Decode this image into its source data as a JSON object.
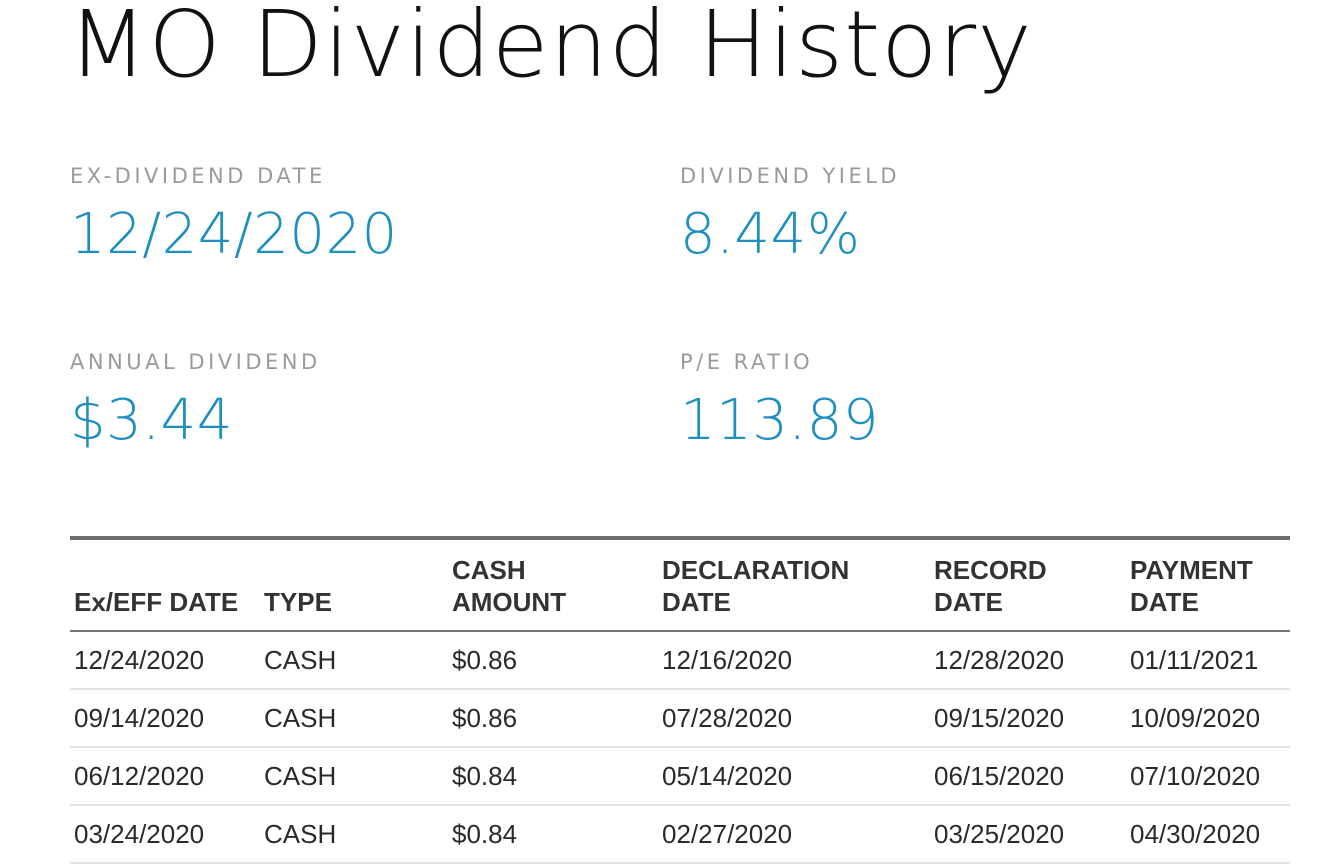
{
  "page": {
    "title": "MO Dividend History"
  },
  "stats": {
    "ex_dividend_date": {
      "label": "EX-DIVIDEND DATE",
      "value": "12/24/2020"
    },
    "dividend_yield": {
      "label": "DIVIDEND YIELD",
      "value": "8.44%"
    },
    "annual_dividend": {
      "label": "ANNUAL DIVIDEND",
      "value": "$3.44"
    },
    "pe_ratio": {
      "label": "P/E RATIO",
      "value": "113.89"
    }
  },
  "colors": {
    "accent": "#1e8fbf",
    "label_gray": "#9a9a9a"
  },
  "table": {
    "headers": {
      "ex_eff_date": "Ex/EFF DATE",
      "type": "TYPE",
      "cash_amount_1": "CASH",
      "cash_amount_2": "AMOUNT",
      "declaration_date_1": "DECLARATION",
      "declaration_date_2": "DATE",
      "record_date_1": "RECORD",
      "record_date_2": "DATE",
      "payment_date_1": "PAYMENT",
      "payment_date_2": "DATE"
    },
    "rows": [
      {
        "ex_eff_date": "12/24/2020",
        "type": "CASH",
        "cash_amount": "$0.86",
        "declaration_date": "12/16/2020",
        "record_date": "12/28/2020",
        "payment_date": "01/11/2021"
      },
      {
        "ex_eff_date": "09/14/2020",
        "type": "CASH",
        "cash_amount": "$0.86",
        "declaration_date": "07/28/2020",
        "record_date": "09/15/2020",
        "payment_date": "10/09/2020"
      },
      {
        "ex_eff_date": "06/12/2020",
        "type": "CASH",
        "cash_amount": "$0.84",
        "declaration_date": "05/14/2020",
        "record_date": "06/15/2020",
        "payment_date": "07/10/2020"
      },
      {
        "ex_eff_date": "03/24/2020",
        "type": "CASH",
        "cash_amount": "$0.84",
        "declaration_date": "02/27/2020",
        "record_date": "03/25/2020",
        "payment_date": "04/30/2020"
      }
    ]
  }
}
